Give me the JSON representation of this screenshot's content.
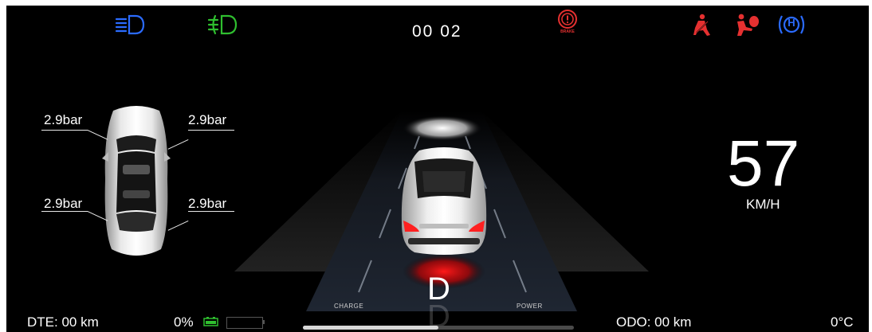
{
  "clock": "00 02",
  "indicators": {
    "left": [
      {
        "name": "low-beam-icon",
        "color": "#2b6bff"
      },
      {
        "name": "fog-light-icon",
        "color": "#2fbf2f"
      }
    ],
    "center": {
      "name": "brake-warning-icon",
      "color": "#e53030",
      "sublabel": "BRAKE"
    },
    "right": [
      {
        "name": "seatbelt-warning-icon",
        "color": "#e53030"
      },
      {
        "name": "airbag-warning-icon",
        "color": "#e53030"
      },
      {
        "name": "hold-icon",
        "color": "#2b6bff",
        "label": "H"
      }
    ]
  },
  "tires": {
    "front_left": "2.9bar",
    "front_right": "2.9bar",
    "rear_left": "2.9bar",
    "rear_right": "2.9bar"
  },
  "speed": {
    "value": "57",
    "unit": "KM/H"
  },
  "gear": "D",
  "power_meter": {
    "left_label": "CHARGE",
    "right_label": "POWER",
    "level": 0.5
  },
  "bottom": {
    "dte": "DTE: 00 km",
    "battery_percent": "0%",
    "battery_level": 0,
    "odo": "ODO: 00 km",
    "temperature": "0°C"
  }
}
